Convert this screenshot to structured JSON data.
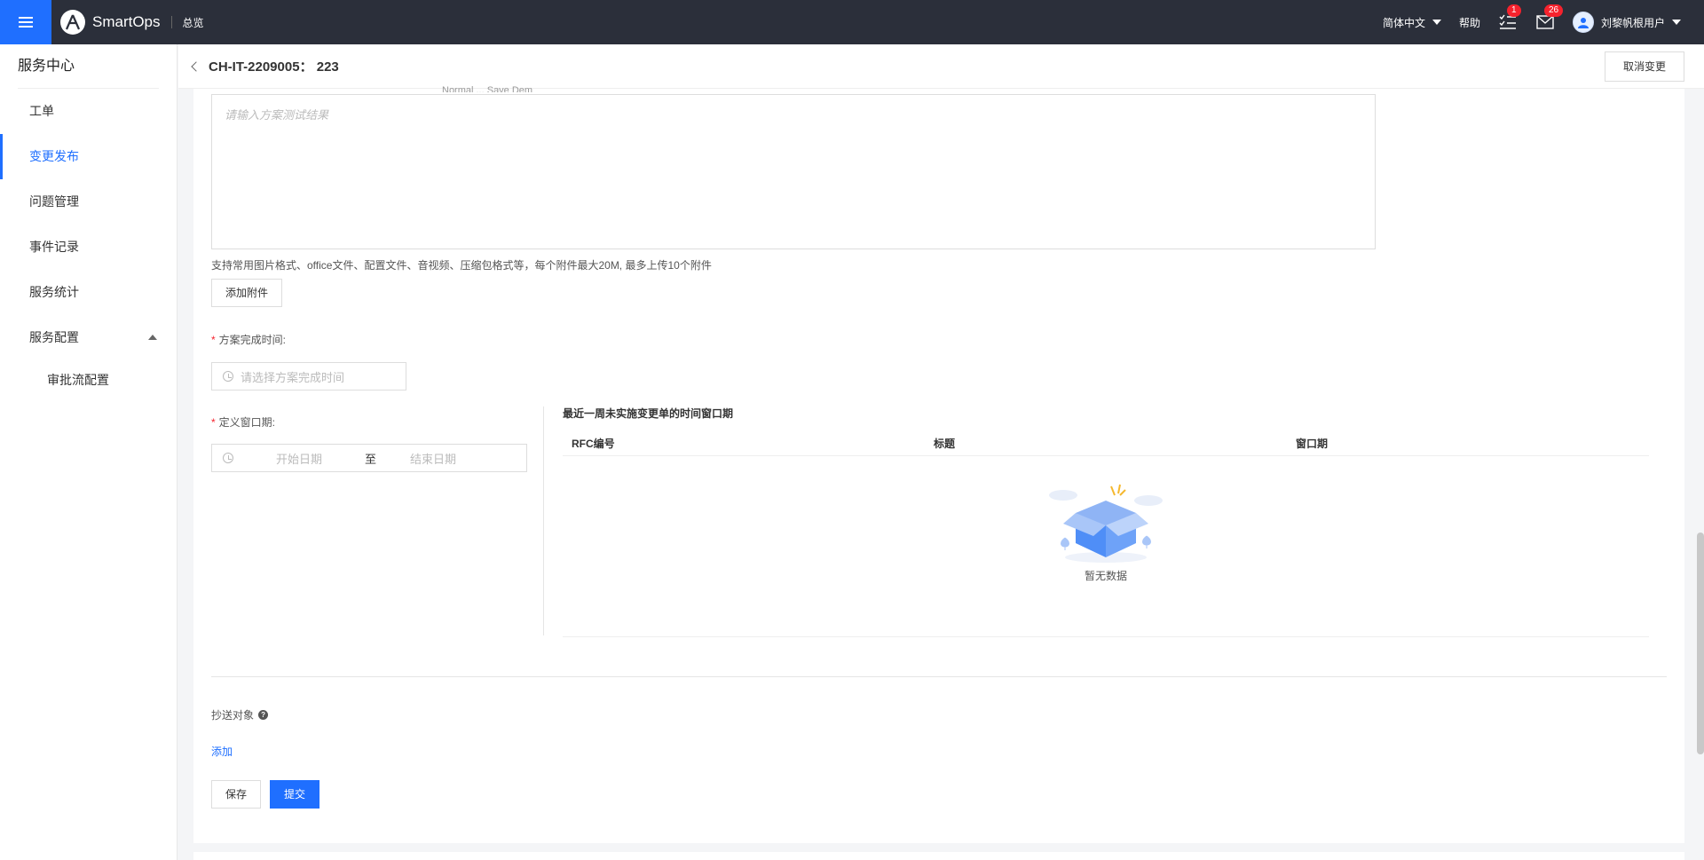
{
  "topbar": {
    "app_name": "SmartOps",
    "nav_overview": "总览",
    "language": "简体中文",
    "help": "帮助",
    "tasks_badge": "1",
    "messages_badge": "26",
    "user_name": "刘黎帆根用户"
  },
  "sidebar": {
    "title": "服务中心",
    "items": [
      {
        "label": "工单"
      },
      {
        "label": "变更发布"
      },
      {
        "label": "问题管理"
      },
      {
        "label": "事件记录"
      },
      {
        "label": "服务统计"
      },
      {
        "label": "服务配置"
      }
    ],
    "sub_items": [
      {
        "label": "审批流配置"
      }
    ]
  },
  "header": {
    "title": "CH-IT-2209005：  223",
    "cancel_label": "取消变更"
  },
  "form": {
    "cut_row_text": "Normal          ...       Save Dem",
    "test_result_placeholder": "请输入方案测试结果",
    "attachment_hint": "支持常用图片格式、office文件、配置文件、音视频、压缩包格式等，每个附件最大20M, 最多上传10个附件",
    "add_attachment": "添加附件",
    "completion_time_label": "方案完成时间:",
    "completion_time_placeholder": "请选择方案完成时间",
    "window_label": "定义窗口期:",
    "start_date_placeholder": "开始日期",
    "range_separator": "至",
    "end_date_placeholder": "结束日期",
    "window_table_title": "最近一周未实施变更单的时间窗口期",
    "window_table_headers": [
      "RFC编号",
      "标题",
      "窗口期"
    ],
    "empty_text": "暂无数据",
    "cc_label": "抄送对象",
    "add_link": "添加",
    "save_label": "保存",
    "submit_label": "提交"
  },
  "colors": {
    "primary": "#1f6fff",
    "topbar": "#2b2f3a",
    "badge": "#f5222d"
  }
}
